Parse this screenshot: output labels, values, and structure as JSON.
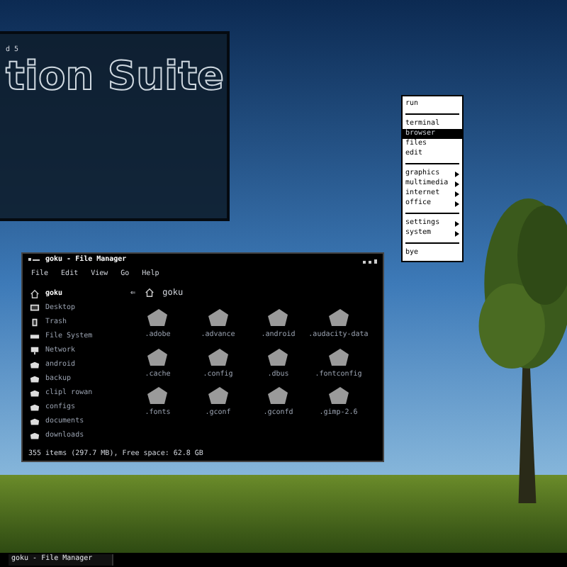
{
  "splash": {
    "subtitle": "d 5",
    "title": "tion Suite"
  },
  "menu": [
    {
      "kind": "item",
      "label": "run",
      "selected": false,
      "submenu": false
    },
    {
      "kind": "separator"
    },
    {
      "kind": "item",
      "label": "terminal",
      "selected": false,
      "submenu": false
    },
    {
      "kind": "item",
      "label": "browser",
      "selected": true,
      "submenu": false
    },
    {
      "kind": "item",
      "label": "files",
      "selected": false,
      "submenu": false
    },
    {
      "kind": "item",
      "label": "edit",
      "selected": false,
      "submenu": false
    },
    {
      "kind": "separator"
    },
    {
      "kind": "item",
      "label": "graphics",
      "selected": false,
      "submenu": true
    },
    {
      "kind": "item",
      "label": "multimedia",
      "selected": false,
      "submenu": true
    },
    {
      "kind": "item",
      "label": "internet",
      "selected": false,
      "submenu": true
    },
    {
      "kind": "item",
      "label": "office",
      "selected": false,
      "submenu": true
    },
    {
      "kind": "separator"
    },
    {
      "kind": "item",
      "label": "settings",
      "selected": false,
      "submenu": true
    },
    {
      "kind": "item",
      "label": "system",
      "selected": false,
      "submenu": true
    },
    {
      "kind": "separator"
    },
    {
      "kind": "item",
      "label": "bye",
      "selected": false,
      "submenu": false
    }
  ],
  "file_manager": {
    "title": "goku - File Manager",
    "menubar": [
      "File",
      "Edit",
      "View",
      "Go",
      "Help"
    ],
    "sidebar": [
      {
        "label": "goku",
        "kind": "home",
        "selected": true
      },
      {
        "label": "Desktop",
        "kind": "desktop",
        "selected": false
      },
      {
        "label": "Trash",
        "kind": "trash",
        "selected": false
      },
      {
        "label": "File System",
        "kind": "drive",
        "selected": false
      },
      {
        "label": "Network",
        "kind": "network",
        "selected": false
      },
      {
        "label": "android",
        "kind": "folder",
        "selected": false
      },
      {
        "label": "backup",
        "kind": "folder",
        "selected": false
      },
      {
        "label": "clipl rowan",
        "kind": "folder",
        "selected": false
      },
      {
        "label": "configs",
        "kind": "folder",
        "selected": false
      },
      {
        "label": "documents",
        "kind": "folder",
        "selected": false
      },
      {
        "label": "downloads",
        "kind": "folder",
        "selected": false
      }
    ],
    "back": "⇐",
    "path": "goku",
    "files": [
      ".adobe",
      ".advance",
      ".android",
      ".audacity-data",
      ".cache",
      ".config",
      ".dbus",
      ".fontconfig",
      ".fonts",
      ".gconf",
      ".gconfd",
      ".gimp-2.6"
    ],
    "status": "355 items (297.7 MB), Free space: 62.8 GB"
  },
  "taskbar": {
    "task": "goku - File Manager"
  }
}
